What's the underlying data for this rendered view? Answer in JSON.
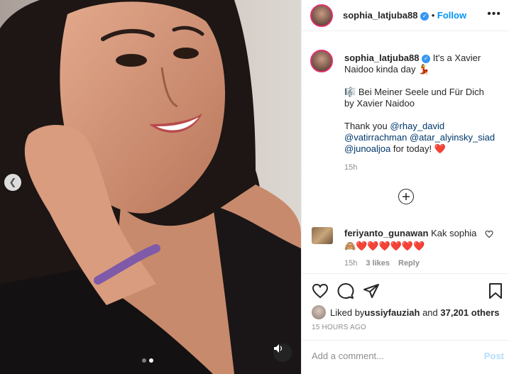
{
  "post": {
    "username": "sophia_latjuba88",
    "verified_icon": "verified-badge-icon",
    "follow_separator": "•",
    "follow_label": "Follow"
  },
  "caption": {
    "username": "sophia_latjuba88",
    "line1": "It's a Xavier",
    "line2": "Naidoo kinda day",
    "line2_emoji": "💃",
    "song_emoji": "🎼",
    "song_line1": "Bei Meiner Seele und Für Dich",
    "song_line2": "by Xavier Naidoo",
    "thanks_prefix": "Thank you ",
    "mention1": "@rhay_david",
    "mention2": "@vatirrachman",
    "mention3": "@atar_alyinsky_siad",
    "mention4": "@junoaljoa",
    "thanks_suffix": " for today! ",
    "thanks_emoji": "❤️",
    "time": "15h"
  },
  "comment": {
    "username": "feriyanto_gunawan",
    "text": "Kak sophia",
    "emojis": "🙈❤️❤️❤️❤️❤️❤️",
    "time": "15h",
    "likes": "3 likes",
    "reply": "Reply"
  },
  "likes": {
    "prefix": "Liked by ",
    "user": "ussiyfauziah",
    "middle": " and ",
    "count": "37,201 others"
  },
  "timestamp": "15 HOURS AGO",
  "add_comment": {
    "placeholder": "Add a comment...",
    "post_label": "Post"
  },
  "colors": {
    "link": "#0095f6",
    "mention": "#00376b",
    "muted": "#8e8e8e",
    "heart": "#ed4956"
  },
  "carousel": {
    "dots": 2,
    "active_dot": 2
  }
}
